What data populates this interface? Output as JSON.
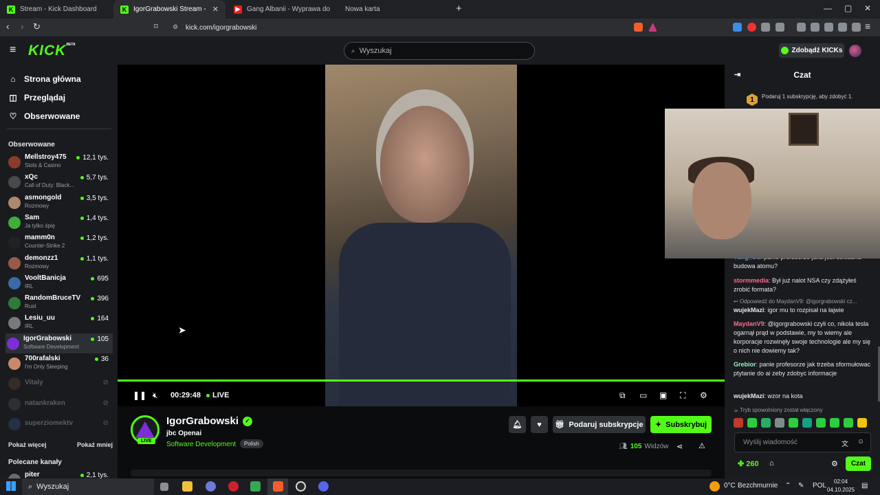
{
  "browser": {
    "tabs": [
      {
        "title": "Stream - Kick Dashboard",
        "icon": "kick-icon"
      },
      {
        "title": "IgorGrabowski Stream - Watch L",
        "icon": "kick-icon",
        "active": true
      },
      {
        "title": "Gang Albanii - Wyprawa do kasyna -",
        "icon": "youtube-icon"
      },
      {
        "title": "Nowa karta",
        "icon": ""
      }
    ],
    "url": "kick.com/igorgrabowski",
    "window_controls": {
      "minimize": "—",
      "maximize": "▢",
      "close": "✕"
    }
  },
  "header": {
    "logo": "KICK",
    "logo_badge": "BETA",
    "search_placeholder": "Wyszukaj",
    "kicks_button": "Zdobądź KICKs"
  },
  "sidebar": {
    "nav": [
      {
        "label": "Strona główna",
        "icon": "home-icon"
      },
      {
        "label": "Przeglądaj",
        "icon": "browse-icon"
      },
      {
        "label": "Obserwowane",
        "icon": "heart-icon"
      }
    ],
    "followed_heading": "Obserwowane",
    "channels": [
      {
        "name": "Mellstroy475",
        "category": "Slots & Casino",
        "viewers": "12,1 tys.",
        "color": "#8a3b2a"
      },
      {
        "name": "xQc",
        "category": "Call of Duty: Black...",
        "viewers": "5,7 tys.",
        "color": "#4a4a4a"
      },
      {
        "name": "asmongold",
        "category": "Rozmowy",
        "viewers": "3,5 tys.",
        "color": "#b08870"
      },
      {
        "name": "Sam",
        "category": "Ja tylko śpię",
        "viewers": "1,4 tys.",
        "color": "#3fae3a"
      },
      {
        "name": "mamm0n",
        "category": "Counter-Strike 2",
        "viewers": "1,2 tys.",
        "color": "#222222"
      },
      {
        "name": "demonzz1",
        "category": "Rozmowy",
        "viewers": "1,1 tys.",
        "color": "#9a5a4a"
      },
      {
        "name": "VooltBanicja",
        "category": "IRL",
        "viewers": "695",
        "color": "#3a6aa8"
      },
      {
        "name": "RandomBruceTV",
        "category": "Rust",
        "viewers": "396",
        "color": "#2e7a3a"
      },
      {
        "name": "Lesiu_uu",
        "category": "IRL",
        "viewers": "164",
        "color": "#7a7a7a"
      },
      {
        "name": "IgorGrabowski",
        "category": "Software Development",
        "viewers": "105",
        "color": "#7c2fd6",
        "active": true
      },
      {
        "name": "700rafalski",
        "category": "I'm Only Sleeping",
        "viewers": "36",
        "color": "#c98a6a"
      }
    ],
    "offline": [
      {
        "name": "Vitaly",
        "color": "#6a4a3a"
      },
      {
        "name": "natankraken",
        "color": "#555555"
      },
      {
        "name": "superziomektv",
        "color": "#3a5a8a"
      }
    ],
    "show_more": "Pokaż więcej",
    "show_less": "Pokaż mniej",
    "recommended_heading": "Polecane kanały",
    "recommended_partial": {
      "name": "piter",
      "viewers": "2,1 tys."
    }
  },
  "player": {
    "time": "00:29:48",
    "live_label": "LIVE",
    "progress": 1.0
  },
  "stream": {
    "streamer": "IgorGrabowski",
    "live_badge": "LIVE",
    "title": "jbc Openai",
    "category": "Software Development",
    "language": "Polish",
    "gift_button": "Podaruj subskrypcje",
    "subscribe_button": "Subskrybuj",
    "viewers_count": "105",
    "viewers_label": "Widzów"
  },
  "chat": {
    "title": "Czat",
    "gift_banner_level": "1",
    "gift_banner": "Podaruj 1 subskrypcję, aby zdobyć 1.",
    "messages": [
      {
        "user": "Yang_Ou",
        "color": "#5aa0ff",
        "text": ": panie profesorze jaka jest dokładna budowa atomu?"
      },
      {
        "user": "stormmedia",
        "color": "#ff6b8a",
        "text": ": Był już nalot NSA czy zdążyłeś zrobić formata?"
      },
      {
        "user": "wujekMazi",
        "color": "#ffffff",
        "text": ": igor mu to rozpisał na łajwie"
      },
      {
        "user": "MaydanV9",
        "color": "#ff6b8a",
        "text": ": @igorgrabowski czyli co, nikola tesla ogarnął prąd w podstawie, my to wiemy ale korporacje rozwinęły swoje technologie ale my się o nich nie dowiemy tak?"
      },
      {
        "user": "Grebior",
        "color": "#9ef0c4",
        "text": ": panie profesorze jak trzeba sformułowac ptytanie do ai zeby zdobyc informacje"
      },
      {
        "user": "wujekMazi",
        "color": "#ffffff",
        "text": ": wzor na kota"
      }
    ],
    "reply_note": "Odpowiedź do MaydanV9: @igorgrabowski cz...",
    "slow_mode": "Tryb spowolniony został włączony",
    "input_placeholder": "Wyślij wiadomość",
    "points": "260",
    "send_button": "Czat"
  },
  "taskbar": {
    "search": "Wyszukaj",
    "weather_temp": "0°C",
    "weather_text": "Bezchmurnie",
    "lang": "POL",
    "time": "02:04",
    "date": "04.10.2025"
  }
}
